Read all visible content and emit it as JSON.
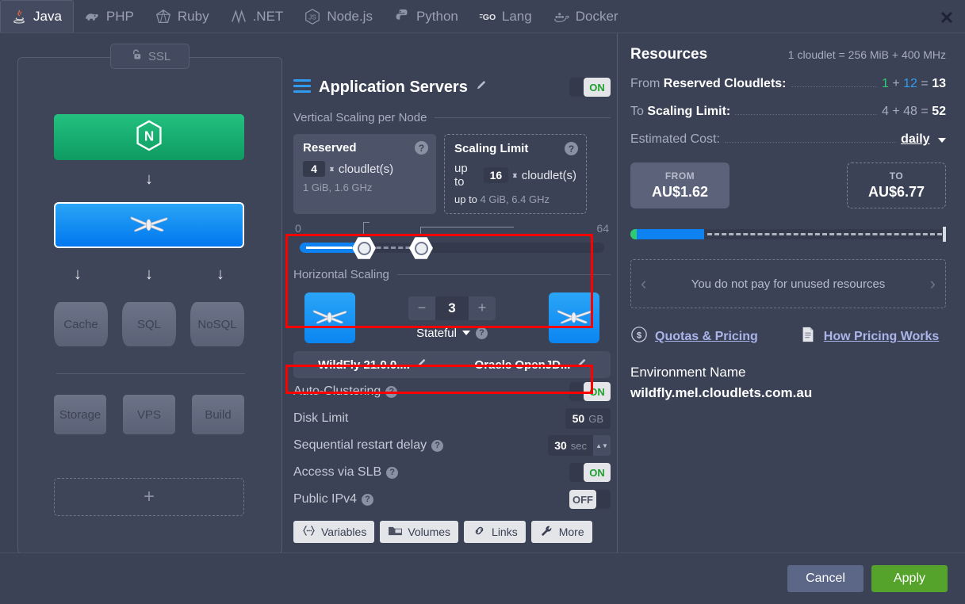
{
  "tabs": [
    {
      "label": "Java",
      "icon": "java-icon",
      "active": true
    },
    {
      "label": "PHP",
      "icon": "php-icon",
      "active": false
    },
    {
      "label": "Ruby",
      "icon": "ruby-icon",
      "active": false
    },
    {
      "label": ".NET",
      "icon": "dotnet-icon",
      "active": false
    },
    {
      "label": "Node.js",
      "icon": "nodejs-icon",
      "active": false
    },
    {
      "label": "Python",
      "icon": "python-icon",
      "active": false
    },
    {
      "label": "Lang",
      "icon": "go-icon",
      "active": false
    },
    {
      "label": "Docker",
      "icon": "docker-icon",
      "active": false
    }
  ],
  "window": {
    "close_label": "✕"
  },
  "topology": {
    "ssl_label": "SSL",
    "balancer_node": "nginx-balancer-node",
    "app_node": "wildfly-app-node",
    "databases": [
      {
        "label": "Cache"
      },
      {
        "label": "SQL"
      },
      {
        "label": "NoSQL"
      }
    ],
    "services": [
      {
        "label": "Storage"
      },
      {
        "label": "VPS"
      },
      {
        "label": "Build"
      }
    ],
    "add_label": "+"
  },
  "center": {
    "title": "Application Servers",
    "title_toggle": "ON",
    "vertical_legend": "Vertical Scaling per Node",
    "reserved": {
      "title": "Reserved",
      "value": "4",
      "unit": "cloudlet(s)",
      "sub": "1 GiB, 1.6 GHz",
      "help": "?"
    },
    "scaling_limit": {
      "title": "Scaling Limit",
      "prefix": "up to",
      "value": "16",
      "unit": "cloudlet(s)",
      "sub_prefix": "up to",
      "sub": "4 GiB, 6.4 GHz",
      "help": "?"
    },
    "slider": {
      "min": "0",
      "max": "64"
    },
    "horizontal_legend": "Horizontal Scaling",
    "horizontal": {
      "minus": "−",
      "count": "3",
      "plus": "+",
      "mode": "Stateful",
      "help": "?"
    },
    "stack": {
      "engine": "WildFly 21.0.0....",
      "jdk": "Oracle OpenJD..."
    },
    "settings": [
      {
        "label": "Auto-Clustering",
        "help": "?",
        "control": "toggle",
        "value": "ON"
      },
      {
        "label": "Disk Limit",
        "help": "",
        "control": "value",
        "value": "50",
        "unit": "GB"
      },
      {
        "label": "Sequential restart delay",
        "help": "?",
        "control": "stepper",
        "value": "30",
        "unit": "sec"
      },
      {
        "label": "Access via SLB",
        "help": "?",
        "control": "toggle",
        "value": "ON"
      },
      {
        "label": "Public IPv4",
        "help": "?",
        "control": "toggle_off",
        "value": "OFF"
      }
    ],
    "buttons": [
      {
        "label": "Variables",
        "icon": "braces-icon"
      },
      {
        "label": "Volumes",
        "icon": "folder-icon"
      },
      {
        "label": "Links",
        "icon": "link-icon"
      },
      {
        "label": "More",
        "icon": "wrench-icon"
      }
    ]
  },
  "resources": {
    "title": "Resources",
    "note": "1 cloudlet = 256 MiB + 400 MHz",
    "from_reserved_label_prefix": "From ",
    "from_reserved_label_bold": "Reserved Cloudlets:",
    "from_reserved_a": "1",
    "from_reserved_plus": "+",
    "from_reserved_b": "12",
    "from_reserved_eq": "=",
    "from_reserved_total": "13",
    "to_limit_label_prefix": "To ",
    "to_limit_label_bold": "Scaling Limit:",
    "to_limit_a": "4",
    "to_limit_plus": "+",
    "to_limit_b": "48",
    "to_limit_eq": "=",
    "to_limit_total": "52",
    "cost_label": "Estimated Cost:",
    "cost_period": "daily",
    "price_from_cap": "FROM",
    "price_from": "AU$1.62",
    "price_to_cap": "TO",
    "price_to": "AU$6.77",
    "unused_text": "You do not pay for unused resources",
    "unused_prev": "‹",
    "unused_next": "›",
    "link_quotas": "Quotas & Pricing",
    "link_pricing": "How Pricing Works",
    "env_label": "Environment Name",
    "env_value": "wildfly.mel.cloudlets.com.au"
  },
  "footer": {
    "cancel": "Cancel",
    "apply": "Apply"
  },
  "colors": {
    "accent_blue": "#0e82f0",
    "green": "#2ecc71",
    "apply_green": "#55a32a",
    "highlight_red": "#ff0000",
    "panel_bg": "#3b4256"
  }
}
